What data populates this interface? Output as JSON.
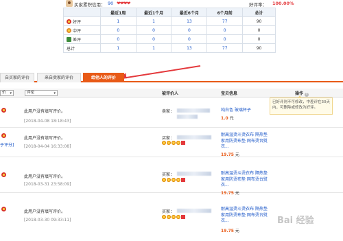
{
  "header": {
    "credit_label": "买家累积信用：",
    "credit_score": "90",
    "hearts": "❤❤❤❤",
    "rate_label": "好评率：",
    "rate_value": "100.00%"
  },
  "summary": {
    "columns": [
      "",
      "最近1周",
      "最近1个月",
      "最近6个月",
      "6个月前",
      "总计"
    ],
    "rows": [
      {
        "label": "好评",
        "values": [
          "1",
          "1",
          "13",
          "77",
          "90"
        ]
      },
      {
        "label": "中评",
        "values": [
          "0",
          "0",
          "0",
          "0",
          "0"
        ]
      },
      {
        "label": "差评",
        "values": [
          "0",
          "0",
          "0",
          "0",
          "0"
        ]
      },
      {
        "label": "总计",
        "values": [
          "1",
          "1",
          "13",
          "77",
          "90"
        ]
      }
    ]
  },
  "tabs": {
    "t1": "自买家的评价",
    "t2": "来自卖家的评价",
    "t3": "给他人的评价"
  },
  "list_header": {
    "select_1": "价",
    "select_2": "评论",
    "col_rated": "被评价人",
    "col_item": "宝贝信息",
    "col_action": "操作"
  },
  "tooltip": "已好评则不可修改，中差评在30天内，可删除或修改为好评。",
  "rows": [
    {
      "comment": "此用户没有填写评价。",
      "time": "[2018-04-08 18:18:43]",
      "extra": "",
      "role": "卖家：",
      "item": "纯白色 玻璃杯子",
      "price": "1.0",
      "unit": "元"
    },
    {
      "comment": "此用户没有填写评价。",
      "time": "[2018-04-04 16:33:08]",
      "extra": "于评分]",
      "role": "买家：",
      "item": "耐高温烫斗烫衣布 隔热垫 家用防烫布垫 网布烫台熨衣...",
      "price": "19.75",
      "unit": "元"
    },
    {
      "comment": "此用户没有填写评价。",
      "time": "[2018-03-31 23:58:09]",
      "extra": "",
      "role": "买家：",
      "item": "耐高温烫斗烫衣布 隔热垫 家用防烫布垫 网布烫台熨衣...",
      "price": "19.75",
      "unit": "元"
    },
    {
      "comment": "此用户没有填写评价。",
      "time": "[2018-03-30 09:33:11]",
      "extra": "",
      "role": "买家：",
      "item": "耐高温烫斗烫衣布 隔热垫 家用防烫布垫 网布烫台熨衣...",
      "price": "19.75",
      "unit": "元"
    }
  ],
  "watermark": "Bai 经验"
}
